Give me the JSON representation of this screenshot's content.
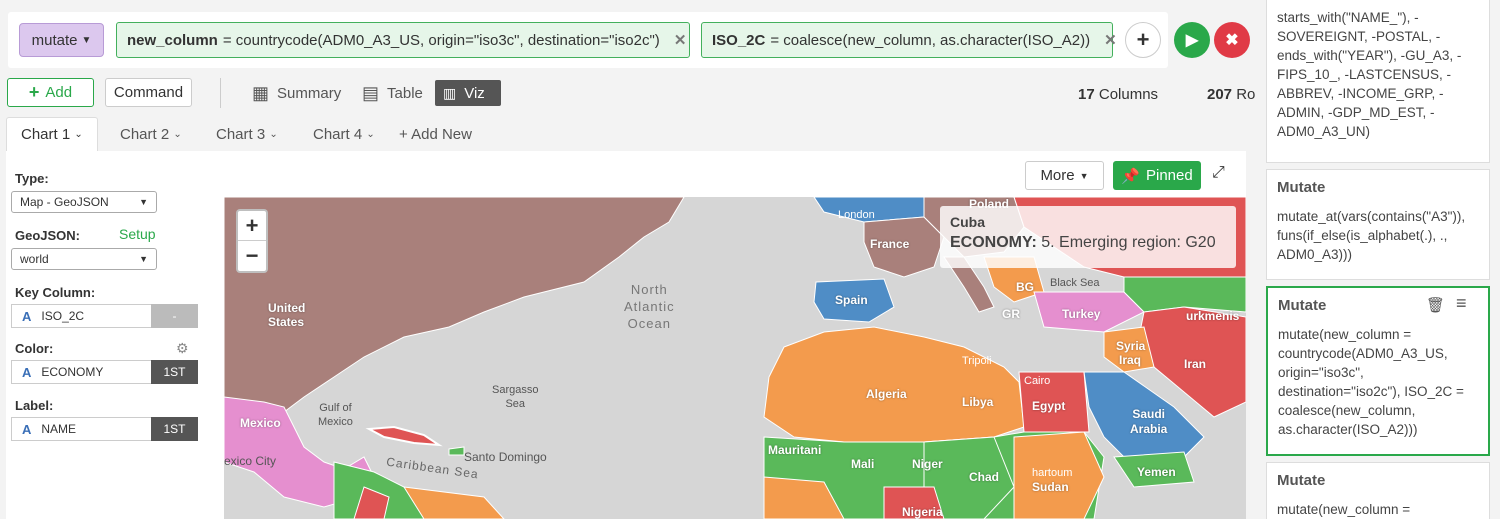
{
  "command_bar": {
    "mutate_label": "mutate",
    "token1": {
      "name": "new_column",
      "expr": "= countrycode(ADM0_A3_US, origin=\"iso3c\", destination=\"iso2c\")"
    },
    "token2": {
      "name": "ISO_2C",
      "expr": "= coalesce(new_column, as.character(ISO_A2))"
    },
    "plus_icon": "+"
  },
  "toolbar": {
    "add_label": "Add",
    "command_label": "Command",
    "summary_label": "Summary",
    "table_label": "Table",
    "viz_label": "Viz",
    "columns_count": "17",
    "columns_label": "Columns",
    "rows_count": "207",
    "rows_label": "Rows"
  },
  "tabs": [
    {
      "label": "Chart 1"
    },
    {
      "label": "Chart 2"
    },
    {
      "label": "Chart 3"
    },
    {
      "label": "Chart 4"
    },
    {
      "label": "+ Add New"
    }
  ],
  "settings": {
    "type_label": "Type:",
    "type_value": "Map - GeoJSON",
    "geojson_label": "GeoJSON:",
    "setup_label": "Setup",
    "geojson_value": "world",
    "key_label": "Key Column:",
    "key_value": "ISO_2C",
    "key_btn": "-",
    "color_label": "Color:",
    "color_value": "ECONOMY",
    "color_btn": "1ST",
    "label_label": "Label:",
    "label_value": "NAME",
    "label_btn": "1ST"
  },
  "viz_toolbar": {
    "more_label": "More",
    "pinned_label": "Pinned"
  },
  "map": {
    "zoom_in": "+",
    "zoom_out": "−",
    "tooltip_country": "Cuba",
    "tooltip_key": "ECONOMY:",
    "tooltip_value": "5. Emerging region: G20",
    "labels": {
      "usa": "United\nStates",
      "mexico": "Mexico",
      "gulf": "Gulf of\nMexico",
      "sargasso": "Sargasso\nSea",
      "atlantic": "North\nAtlantic\nOcean",
      "caribbean": "Caribbean Sea",
      "santo_domingo": "Santo Domingo",
      "mexico_city": "exico City",
      "algeria": "Algeria",
      "libya": "Libya",
      "egypt": "Egypt",
      "mali": "Mali",
      "niger": "Niger",
      "chad": "Chad",
      "sudan": "Sudan",
      "nigeria": "Nigeria",
      "mauritania": "Mauritani",
      "spain": "Spain",
      "france": "France",
      "poland": "Poland",
      "turkey": "Turkey",
      "iran": "Iran",
      "iraq": "Iraq",
      "syria": "Syria",
      "saudi": "Saudi\nArabia",
      "yemen": "Yemen",
      "black_sea": "Black Sea",
      "tripoli": "Tripoli",
      "cairo": "Cairo",
      "khartoum": "hartoum",
      "london": "London",
      "turkmenistan": "urkmenis",
      "bg": "BG",
      "gr": "GR"
    },
    "colors": {
      "north_america": "#a9807b",
      "mexico": "#e58fcf",
      "emerging": "#f39b4d",
      "europe_blue": "#4f8dc6",
      "green": "#5ab95a",
      "red": "#df5454",
      "pink": "#e58fcf",
      "ocean": "#d6d6d6"
    }
  },
  "steps": [
    {
      "title": "",
      "text": "starts_with(\"NAME_\"), -SOVEREIGNT, -POSTAL, -ends_with(\"YEAR\"), -GU_A3, -FIPS_10_, -LASTCENSUS, -ABBREV, -INCOME_GRP, -ADMIN, -GDP_MD_EST, -ADM0_A3_UN)"
    },
    {
      "title": "Mutate",
      "text": "mutate_at(vars(contains(\"A3\")), funs(if_else(is_alphabet(.), ., ADM0_A3)))"
    },
    {
      "title": "Mutate",
      "text": "mutate(new_column = countrycode(ADM0_A3_US, origin=\"iso3c\", destination=\"iso2c\"), ISO_2C = coalesce(new_column, as.character(ISO_A2)))"
    },
    {
      "title": "Mutate",
      "text": "mutate(new_column ="
    }
  ]
}
